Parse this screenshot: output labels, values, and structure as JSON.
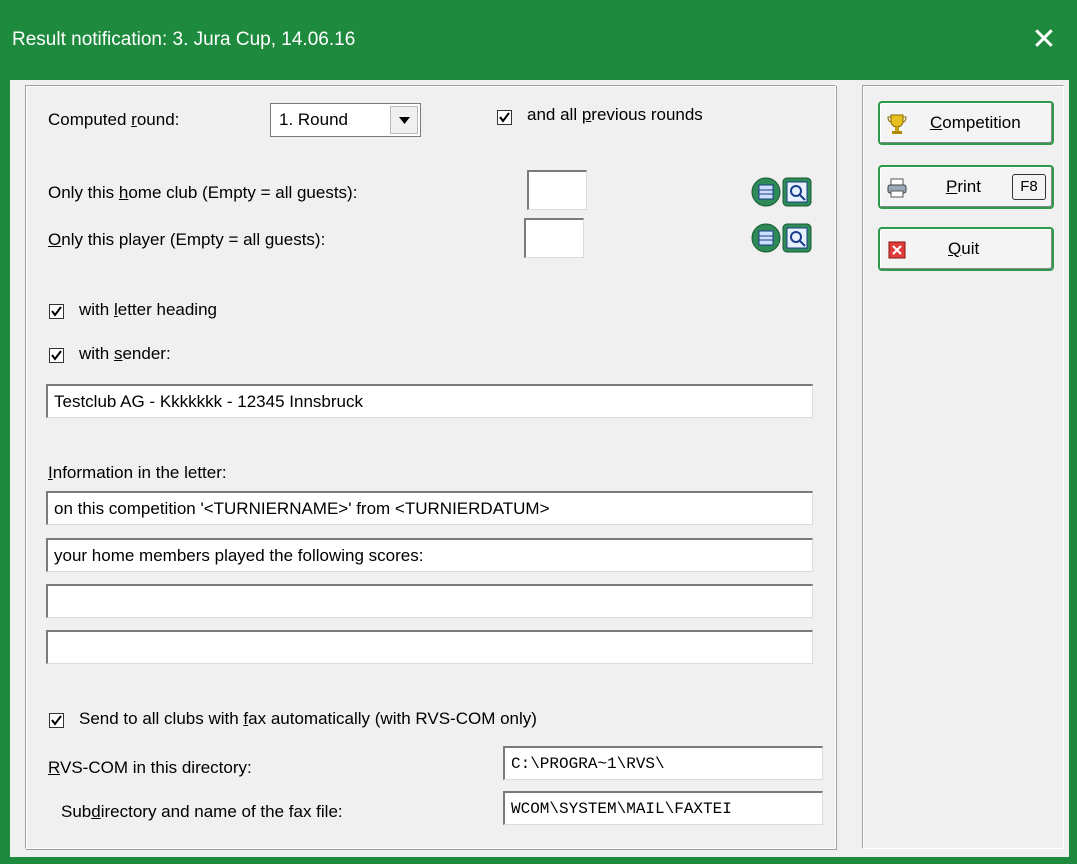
{
  "window": {
    "title": "Result notification: 3. Jura Cup, 14.06.16",
    "close_glyph": "✕"
  },
  "form": {
    "computed_round": {
      "label_pre": "Computed ",
      "label_u": "r",
      "label_post": "ound:",
      "value": "1. Round"
    },
    "all_previous": {
      "label_pre": "and all ",
      "label_u": "p",
      "label_post": "revious rounds",
      "checked": true
    },
    "home_club": {
      "label_pre": "Only this ",
      "label_u": "h",
      "label_post": "ome club (Empty = all guests):",
      "value": ""
    },
    "player": {
      "label_pre": "",
      "label_u": "O",
      "label_post": "nly this player (Empty = all guests):",
      "value": ""
    },
    "letter_heading": {
      "label_pre": "with ",
      "label_u": "l",
      "label_post": "etter heading",
      "checked": true
    },
    "sender": {
      "label_pre": "with ",
      "label_u": "s",
      "label_post": "ender:",
      "checked": true,
      "value": "Testclub AG - Kkkkkkk - 12345 Innsbruck"
    },
    "info": {
      "label_u": "I",
      "label_post": "nformation in the letter:",
      "lines": [
        "on this competition '<TURNIERNAME>' from <TURNIERDATUM>",
        "your home members played the following scores:",
        "",
        ""
      ]
    },
    "fax_auto": {
      "label_pre": "Send to all clubs with ",
      "label_u": "f",
      "label_post": "ax automatically (with RVS-COM only)",
      "checked": true
    },
    "rvs_dir": {
      "label_u": "R",
      "label_post": "VS-COM in this directory:",
      "value": "C:\\PROGRA~1\\RVS\\"
    },
    "fax_file": {
      "label_pre": "Sub",
      "label_u": "d",
      "label_post": "irectory and name of the fax file:",
      "value": "WCOM\\SYSTEM\\MAIL\\FAXTEI"
    }
  },
  "buttons": {
    "competition": {
      "label_u": "C",
      "label_post": "ompetition",
      "icon": "trophy-icon"
    },
    "print": {
      "label_u": "P",
      "label_post": "rint",
      "key": "F8",
      "icon": "printer-icon"
    },
    "quit": {
      "label_u": "Q",
      "label_post": "uit",
      "icon": "close-red-icon"
    }
  },
  "colors": {
    "titlebar": "#1e8a3e",
    "button_border": "#2f9a4c"
  }
}
